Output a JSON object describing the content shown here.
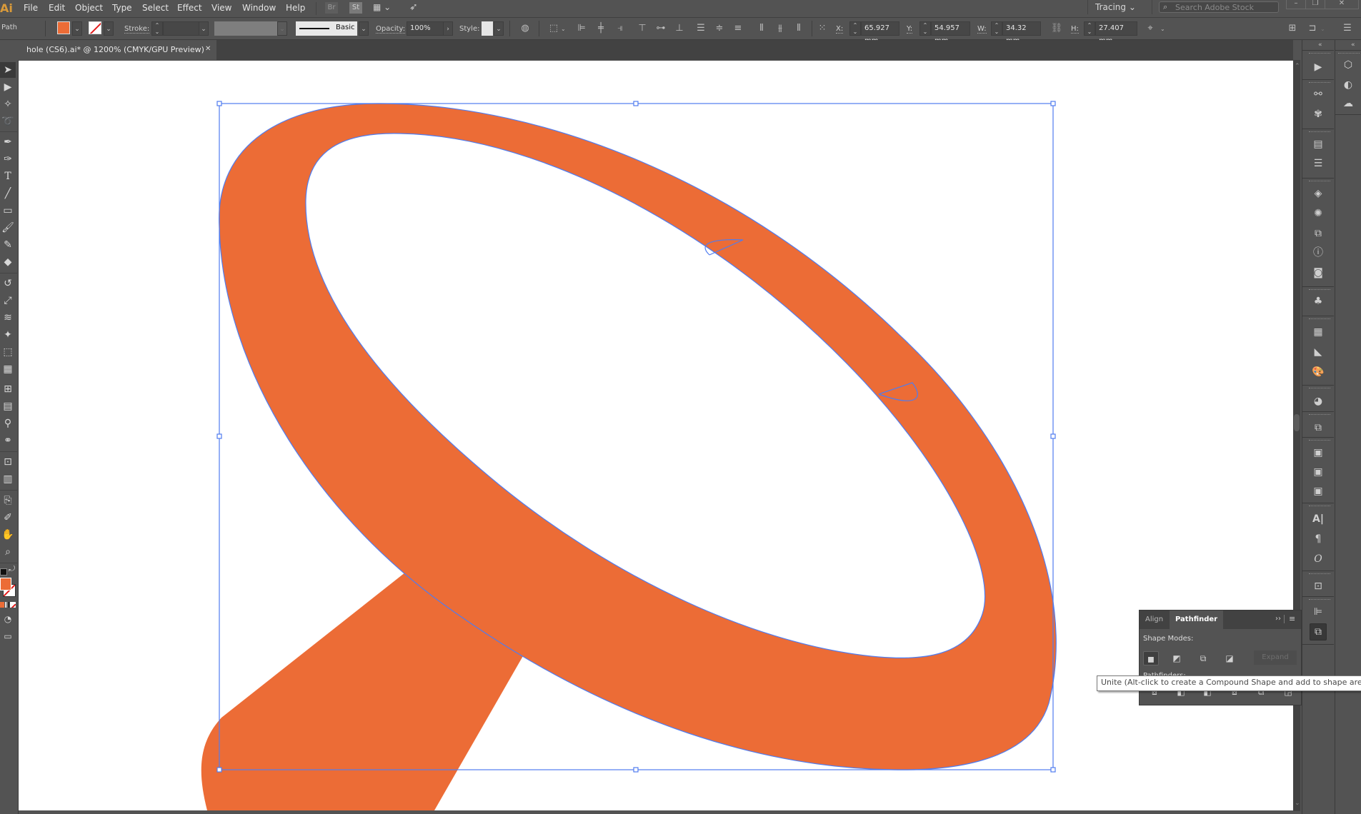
{
  "app": {
    "logo": "Ai",
    "accent": "#d99a3a"
  },
  "menu": [
    "File",
    "Edit",
    "Object",
    "Type",
    "Select",
    "Effect",
    "View",
    "Window",
    "Help"
  ],
  "menubar_buttons": {
    "bridge": "Br",
    "stock": "St"
  },
  "workspace": {
    "label": "Tracing"
  },
  "search": {
    "placeholder": "Search Adobe Stock"
  },
  "control_bar": {
    "selection_type": "Path",
    "fill_color": "#ec6c36",
    "stroke_label": "Stroke:",
    "stroke_value": "",
    "brush_label": "Basic",
    "opacity_label": "Opacity:",
    "opacity_value": "100%",
    "style_label": "Style:",
    "x_label": "X:",
    "x_value": "65.927 mm",
    "y_label": "Y:",
    "y_value": "54.957 mm",
    "w_label": "W:",
    "w_value": "34.32 mm",
    "h_label": "H:",
    "h_value": "27.407 mm"
  },
  "document": {
    "tab_title": "hole (CS6).ai* @ 1200% (CMYK/GPU Preview)",
    "zoom": "1200%",
    "color_mode": "CMYK/GPU Preview"
  },
  "canvas": {
    "shape_fill": "#ec6c36",
    "selection_color": "#4f7cf0",
    "artboard_color": "#ffffff"
  },
  "tools": [
    "selection",
    "direct-selection",
    "magic-wand",
    "lasso",
    "pen",
    "curvature",
    "type",
    "line-segment",
    "rectangle",
    "paintbrush",
    "shaper",
    "eraser",
    "rotate",
    "scale",
    "warp",
    "free-transform",
    "shape-builder",
    "perspective-grid",
    "mesh",
    "gradient",
    "eyedropper",
    "blend",
    "symbol-sprayer",
    "column-graph",
    "artboard",
    "slice",
    "hand",
    "zoom"
  ],
  "pathfinder_panel": {
    "tabs": [
      "Align",
      "Pathfinder"
    ],
    "active_tab": "Pathfinder",
    "shape_modes_label": "Shape Modes:",
    "pathfinders_label": "Pathfinders:",
    "expand_label": "Expand",
    "shape_modes": [
      "Unite",
      "Minus Front",
      "Intersect",
      "Exclude"
    ],
    "pathfinders": [
      "Divide",
      "Trim",
      "Merge",
      "Crop",
      "Outline",
      "Minus Back"
    ]
  },
  "tooltip": {
    "text": "Unite (Alt-click to create a Compound Shape and add to shape area)"
  },
  "dock_icons": [
    "actions",
    "links",
    "cc-libraries-brush",
    "gradient",
    "stroke",
    "layers",
    "appearance",
    "transform",
    "info",
    "graphic-styles",
    "symbols",
    "swatches",
    "color-guide",
    "color",
    "transparency",
    "pathfinder-shape",
    "asset-export",
    "artboards",
    "image",
    "character",
    "paragraph",
    "opentype",
    "transform-bounds",
    "align",
    "pathfinder"
  ],
  "dock2_icons": [
    "libraries",
    "sync",
    "creative-cloud"
  ]
}
